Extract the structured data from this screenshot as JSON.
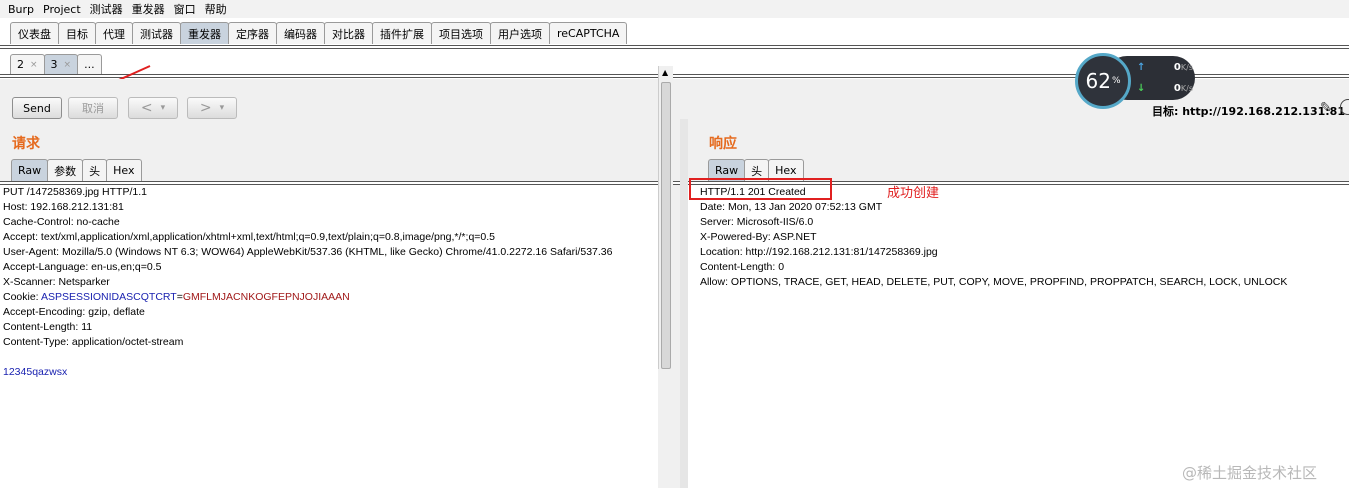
{
  "menubar": [
    "Burp",
    "Project",
    "测试器",
    "重发器",
    "窗口",
    "帮助"
  ],
  "main_tabs": [
    {
      "label": "仪表盘",
      "active": false
    },
    {
      "label": "目标",
      "active": false
    },
    {
      "label": "代理",
      "active": false
    },
    {
      "label": "测试器",
      "active": false
    },
    {
      "label": "重发器",
      "active": true
    },
    {
      "label": "定序器",
      "active": false
    },
    {
      "label": "编码器",
      "active": false
    },
    {
      "label": "对比器",
      "active": false
    },
    {
      "label": "插件扩展",
      "active": false
    },
    {
      "label": "项目选项",
      "active": false
    },
    {
      "label": "用户选项",
      "active": false
    },
    {
      "label": "reCAPTCHA",
      "active": false
    }
  ],
  "sub_tabs": [
    {
      "label": "2",
      "close": "×",
      "active": false
    },
    {
      "label": "3",
      "close": "×",
      "active": true
    },
    {
      "label": "...",
      "close": "",
      "active": false
    }
  ],
  "toolbar": {
    "send_label": "Send",
    "cancel_label": "取消",
    "back_label": "<",
    "forward_label": ">",
    "dropdown_glyph": "▾",
    "target_label": "目标: http://192.168.212.131:81"
  },
  "request": {
    "title": "请求",
    "tabs": [
      "Raw",
      "参数",
      "头",
      "Hex"
    ],
    "active_tab": "Raw",
    "lines": [
      "PUT /147258369.jpg HTTP/1.1",
      "Host: 192.168.212.131:81",
      "Cache-Control: no-cache",
      "Accept: text/xml,application/xml,application/xhtml+xml,text/html;q=0.9,text/plain;q=0.8,image/png,*/*;q=0.5",
      "User-Agent: Mozilla/5.0 (Windows NT 6.3; WOW64) AppleWebKit/537.36 (KHTML, like Gecko) Chrome/41.0.2272.16 Safari/537.36",
      "Accept-Language: en-us,en;q=0.5",
      "X-Scanner: Netsparker"
    ],
    "cookie_prefix": "Cookie: ",
    "cookie_name": "ASPSESSIONIDASCQTCRT",
    "cookie_eq": "=",
    "cookie_value": "GMFLMJACNKOGFEPNJOJIAAAN",
    "lines_after": [
      "Accept-Encoding: gzip, deflate",
      "Content-Length: 11",
      "Content-Type: application/octet-stream"
    ],
    "body": "12345qazwsx"
  },
  "response": {
    "title": "响应",
    "tabs": [
      "Raw",
      "头",
      "Hex"
    ],
    "active_tab": "Raw",
    "lines": [
      "HTTP/1.1 201 Created",
      "Date: Mon, 13 Jan 2020 07:52:13 GMT",
      "Server: Microsoft-IIS/6.0",
      "X-Powered-By: ASP.NET",
      "Location: http://192.168.212.131:81/147258369.jpg",
      "Content-Length: 0",
      "Allow: OPTIONS, TRACE, GET, HEAD, DELETE, PUT, COPY, MOVE, PROPFIND, PROPPATCH, SEARCH, LOCK, UNLOCK"
    ],
    "annotation": "成功创建"
  },
  "net_widget": {
    "percent": "62",
    "percent_sign": "%",
    "upload": "0",
    "download": "0",
    "unit": "K/s",
    "up_arrow": "↑",
    "down_arrow": "↓"
  },
  "watermark": "@稀土掘金技术社区",
  "colors": {
    "accent_orange": "#e56a1e",
    "annotation_red": "#e02020",
    "active_tab": "#c9d3de"
  }
}
